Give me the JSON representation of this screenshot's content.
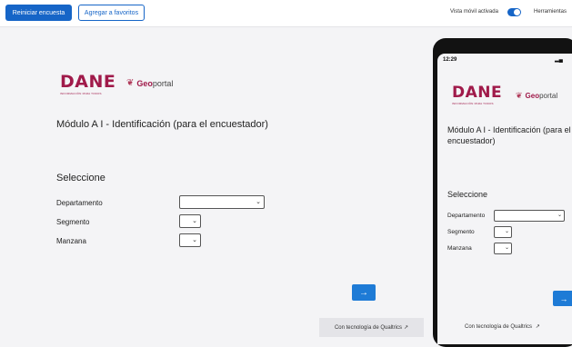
{
  "toolbar": {
    "restart_label": "Reiniciar encuesta",
    "favorites_label": "Agregar a favoritos",
    "mobile_view_label": "Vista móvil activada",
    "mobile_view_on": true,
    "tools_label": "Herramientas"
  },
  "logo": {
    "brand": "DANE",
    "tagline": "INFORMACIÓN PARA TODOS",
    "geo_prefix": "Geo",
    "geo_suffix": "portal"
  },
  "survey": {
    "title": "Módulo A I - Identificación (para el encuestador)",
    "section": "Seleccione",
    "fields": [
      {
        "label": "Departamento",
        "value": ""
      },
      {
        "label": "Segmento",
        "value": ""
      },
      {
        "label": "Manzana",
        "value": ""
      }
    ],
    "next_label": "→",
    "powered_by": "Con tecnología de Qualtrics",
    "powered_icon": "external-link-icon"
  },
  "phone": {
    "time": "12:29",
    "signal": "▂▄"
  },
  "colors": {
    "brand": "#a01a4a",
    "accent": "#1665c7",
    "next_button": "#1e7bd6"
  }
}
